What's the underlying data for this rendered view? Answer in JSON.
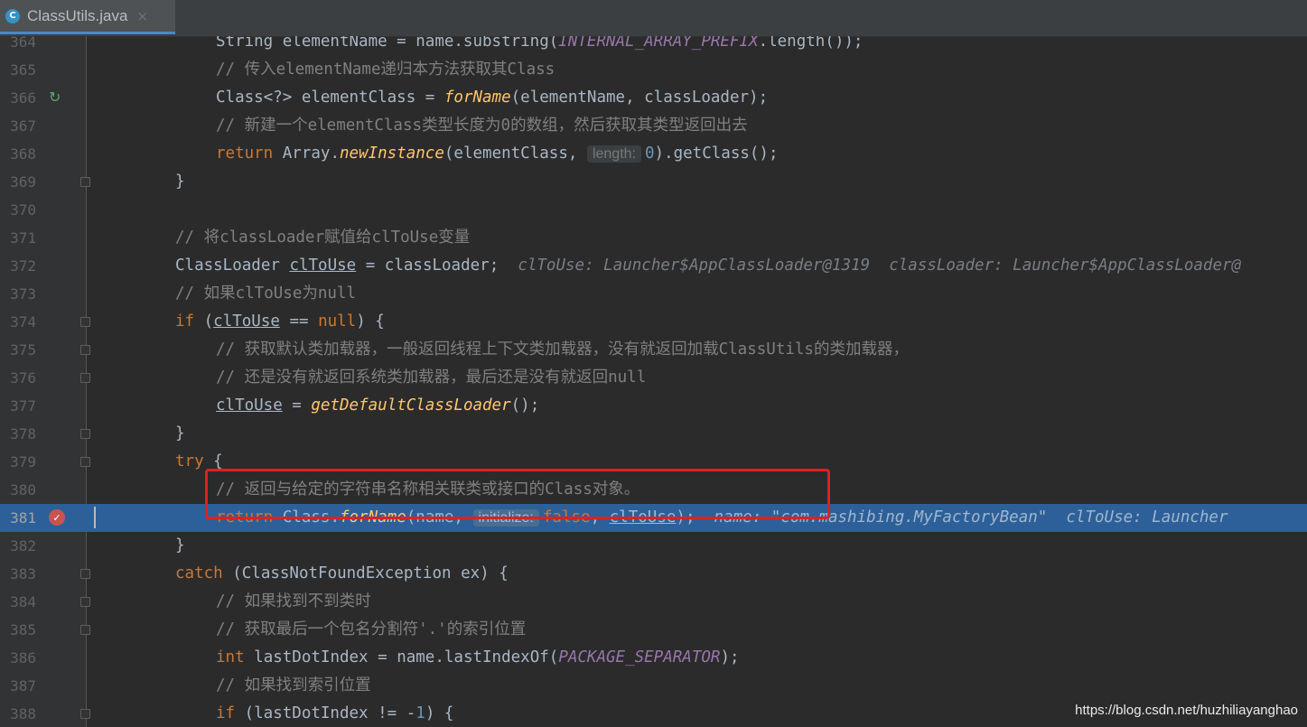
{
  "tab": {
    "icon": "java-class-icon",
    "title": "ClassUtils.java",
    "close": "×"
  },
  "lines": [
    {
      "n": "364",
      "segs": [
        [
          "String elementName = name.substring(",
          ""
        ],
        [
          "INTERNAL_ARRAY_PREFIX",
          "const"
        ],
        [
          ".length());",
          ""
        ]
      ]
    },
    {
      "n": "365",
      "segs": [
        [
          "// 传入elementName递归本方法获取其Class",
          "cm"
        ]
      ]
    },
    {
      "n": "366",
      "segs": [
        [
          "Class<?> elementClass = ",
          ""
        ],
        [
          "forName",
          "fn"
        ],
        [
          "(elementName, classLoader);",
          ""
        ]
      ]
    },
    {
      "n": "367",
      "segs": [
        [
          "// 新建一个elementClass类型长度为0的数组，然后获取其类型返回出去",
          "cm"
        ]
      ]
    },
    {
      "n": "368",
      "segs": [
        [
          "return ",
          "kw"
        ],
        [
          "Array.",
          ""
        ],
        [
          "newInstance",
          "fn"
        ],
        [
          "(elementClass, ",
          ""
        ],
        [
          "length:",
          "hint"
        ],
        [
          "0",
          "num"
        ],
        [
          ").getClass();",
          ""
        ]
      ]
    },
    {
      "n": "369",
      "segs": [
        [
          "}",
          ""
        ]
      ]
    },
    {
      "n": "370",
      "segs": []
    },
    {
      "n": "371",
      "segs": [
        [
          "// 将classLoader赋值给clToUse变量",
          "cm"
        ]
      ]
    },
    {
      "n": "372",
      "segs": [
        [
          "ClassLoader ",
          ""
        ],
        [
          "clToUse",
          "ul"
        ],
        [
          " = classLoader;",
          ""
        ],
        [
          "  clToUse: Launcher$AppClassLoader@1319  classLoader: Launcher$AppClassLoader@",
          "inline-val"
        ]
      ]
    },
    {
      "n": "373",
      "segs": [
        [
          "// 如果clToUse为null",
          "cm"
        ]
      ]
    },
    {
      "n": "374",
      "segs": [
        [
          "if ",
          "kw"
        ],
        [
          "(",
          ""
        ],
        [
          "clToUse",
          "ul"
        ],
        [
          " == ",
          ""
        ],
        [
          "null",
          "kw"
        ],
        [
          ") {",
          ""
        ]
      ]
    },
    {
      "n": "375",
      "segs": [
        [
          "// 获取默认类加载器，一般返回线程上下文类加载器，没有就返回加载ClassUtils的类加载器，",
          "cm"
        ]
      ]
    },
    {
      "n": "376",
      "segs": [
        [
          "// 还是没有就返回系统类加载器，最后还是没有就返回null",
          "cm"
        ]
      ]
    },
    {
      "n": "377",
      "segs": [
        [
          "clToUse",
          "ul"
        ],
        [
          " = ",
          ""
        ],
        [
          "getDefaultClassLoader",
          "fn"
        ],
        [
          "();",
          ""
        ]
      ]
    },
    {
      "n": "378",
      "segs": [
        [
          "}",
          ""
        ]
      ]
    },
    {
      "n": "379",
      "segs": [
        [
          "try ",
          "kw"
        ],
        [
          "{",
          ""
        ]
      ]
    },
    {
      "n": "380",
      "segs": [
        [
          "// 返回与给定的字符串名称相关联类或接口的Class对象。",
          "cm"
        ]
      ]
    },
    {
      "n": "381",
      "segs": [
        [
          "return ",
          "kw"
        ],
        [
          "Class.",
          ""
        ],
        [
          "forName",
          "fn"
        ],
        [
          "(name, ",
          ""
        ],
        [
          "initialize:",
          "hint"
        ],
        [
          "false",
          "kw"
        ],
        [
          ", ",
          ""
        ],
        [
          "clToUse",
          "ul"
        ],
        [
          ");",
          ""
        ],
        [
          "  name: \"com.mashibing.MyFactoryBean\"  clToUse: Launcher",
          "inline-val"
        ]
      ]
    },
    {
      "n": "382",
      "segs": [
        [
          "}",
          ""
        ]
      ]
    },
    {
      "n": "383",
      "segs": [
        [
          "catch ",
          "kw"
        ],
        [
          "(ClassNotFoundException ex) {",
          ""
        ]
      ]
    },
    {
      "n": "384",
      "segs": [
        [
          "// 如果找到不到类时",
          "cm"
        ]
      ]
    },
    {
      "n": "385",
      "segs": [
        [
          "// 获取最后一个包名分割符'.'的索引位置",
          "cm"
        ]
      ]
    },
    {
      "n": "386",
      "segs": [
        [
          "int ",
          "kw"
        ],
        [
          "lastDotIndex = name.lastIndexOf(",
          ""
        ],
        [
          "PACKAGE_SEPARATOR",
          "const"
        ],
        [
          ");",
          ""
        ]
      ]
    },
    {
      "n": "387",
      "segs": [
        [
          "// 如果找到索引位置",
          "cm"
        ]
      ]
    },
    {
      "n": "388",
      "segs": [
        [
          "if ",
          "kw"
        ],
        [
          "(lastDotIndex != -",
          ""
        ],
        [
          "1",
          "num"
        ],
        [
          ") {",
          ""
        ]
      ]
    }
  ],
  "watermark": "https://blog.csdn.net/huzhiliayanghao"
}
